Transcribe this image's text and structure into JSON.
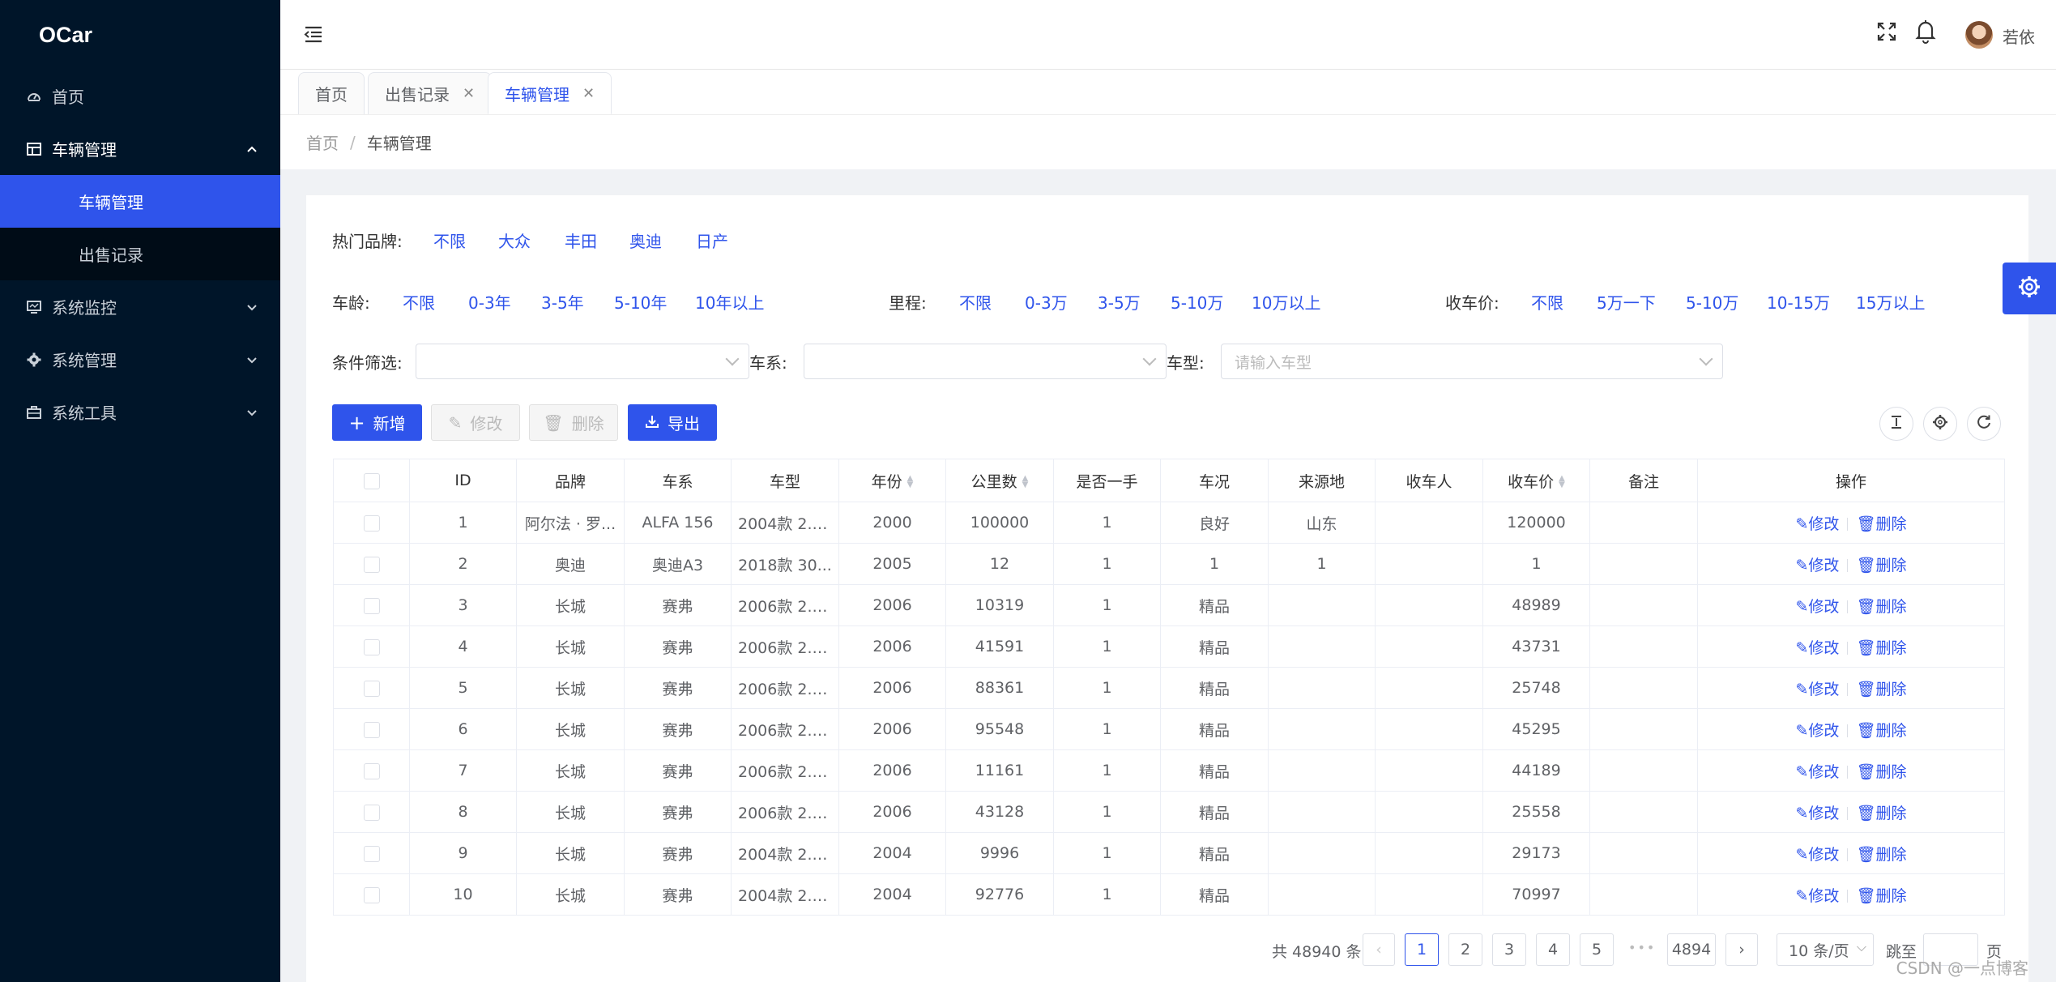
{
  "app": {
    "logo": "OCar"
  },
  "sidebar": {
    "items": [
      {
        "label": "首页",
        "icon": "dashboard-icon"
      },
      {
        "label": "车辆管理",
        "icon": "table-icon",
        "expanded": true,
        "children": [
          {
            "label": "车辆管理",
            "active": true
          },
          {
            "label": "出售记录"
          }
        ]
      },
      {
        "label": "系统监控",
        "icon": "monitor-icon"
      },
      {
        "label": "系统管理",
        "icon": "gear-icon"
      },
      {
        "label": "系统工具",
        "icon": "toolbox-icon"
      }
    ]
  },
  "header": {
    "username": "若依"
  },
  "tabs": [
    {
      "label": "首页"
    },
    {
      "label": "出售记录",
      "closable": true
    },
    {
      "label": "车辆管理",
      "closable": true,
      "active": true
    }
  ],
  "breadcrumb": {
    "home": "首页",
    "sep": "/",
    "current": "车辆管理"
  },
  "filters": {
    "brand": {
      "label": "热门品牌:",
      "options": [
        "不限",
        "大众",
        "丰田",
        "奥迪",
        "日产"
      ]
    },
    "age": {
      "label": "车龄:",
      "options": [
        "不限",
        "0-3年",
        "3-5年",
        "5-10年",
        "10年以上"
      ]
    },
    "mileage": {
      "label": "里程:",
      "options": [
        "不限",
        "0-3万",
        "3-5万",
        "5-10万",
        "10万以上"
      ]
    },
    "price": {
      "label": "收车价:",
      "options": [
        "不限",
        "5万一下",
        "5-10万",
        "10-15万",
        "15万以上"
      ]
    },
    "condition_label": "条件筛选:",
    "series_label": "车系:",
    "model_label": "车型:",
    "model_placeholder": "请输入车型"
  },
  "toolbar": {
    "add": "新增",
    "edit": "修改",
    "delete": "删除",
    "export": "导出"
  },
  "table": {
    "headers": [
      "ID",
      "品牌",
      "车系",
      "车型",
      "年份",
      "公里数",
      "是否一手",
      "车况",
      "来源地",
      "收车人",
      "收车价",
      "备注",
      "操作"
    ],
    "edit_label": "修改",
    "delete_label": "删除",
    "rows": [
      [
        "1",
        "阿尔法 · 罗...",
        "ALFA 156",
        "2004款 2.0 ...",
        "2000",
        "100000",
        "1",
        "良好",
        "山东",
        "",
        "120000",
        ""
      ],
      [
        "2",
        "奥迪",
        "奥迪A3",
        "2018款 30...",
        "2005",
        "12",
        "1",
        "1",
        "1",
        "",
        "1",
        ""
      ],
      [
        "3",
        "长城",
        "赛弗",
        "2006款 2.2...",
        "2006",
        "10319",
        "1",
        "精品",
        "",
        "",
        "48989",
        ""
      ],
      [
        "4",
        "长城",
        "赛弗",
        "2006款 2.2...",
        "2006",
        "41591",
        "1",
        "精品",
        "",
        "",
        "43731",
        ""
      ],
      [
        "5",
        "长城",
        "赛弗",
        "2006款 2.2...",
        "2006",
        "88361",
        "1",
        "精品",
        "",
        "",
        "25748",
        ""
      ],
      [
        "6",
        "长城",
        "赛弗",
        "2006款 2.2...",
        "2006",
        "95548",
        "1",
        "精品",
        "",
        "",
        "45295",
        ""
      ],
      [
        "7",
        "长城",
        "赛弗",
        "2006款 2.2...",
        "2006",
        "11161",
        "1",
        "精品",
        "",
        "",
        "44189",
        ""
      ],
      [
        "8",
        "长城",
        "赛弗",
        "2006款 2.2...",
        "2006",
        "43128",
        "1",
        "精品",
        "",
        "",
        "25558",
        ""
      ],
      [
        "9",
        "长城",
        "赛弗",
        "2004款 2.2...",
        "2004",
        "9996",
        "1",
        "精品",
        "",
        "",
        "29173",
        ""
      ],
      [
        "10",
        "长城",
        "赛弗",
        "2004款 2.2...",
        "2004",
        "92776",
        "1",
        "精品",
        "",
        "",
        "70997",
        ""
      ]
    ]
  },
  "pagination": {
    "total": "共 48940 条",
    "pages": [
      "1",
      "2",
      "3",
      "4",
      "5"
    ],
    "current": "1",
    "ellipsis": "•••",
    "last": "4894",
    "page_size": "10 条/页",
    "jump_label": "跳至",
    "page_suffix": "页"
  },
  "watermark": "CSDN @一点博客"
}
